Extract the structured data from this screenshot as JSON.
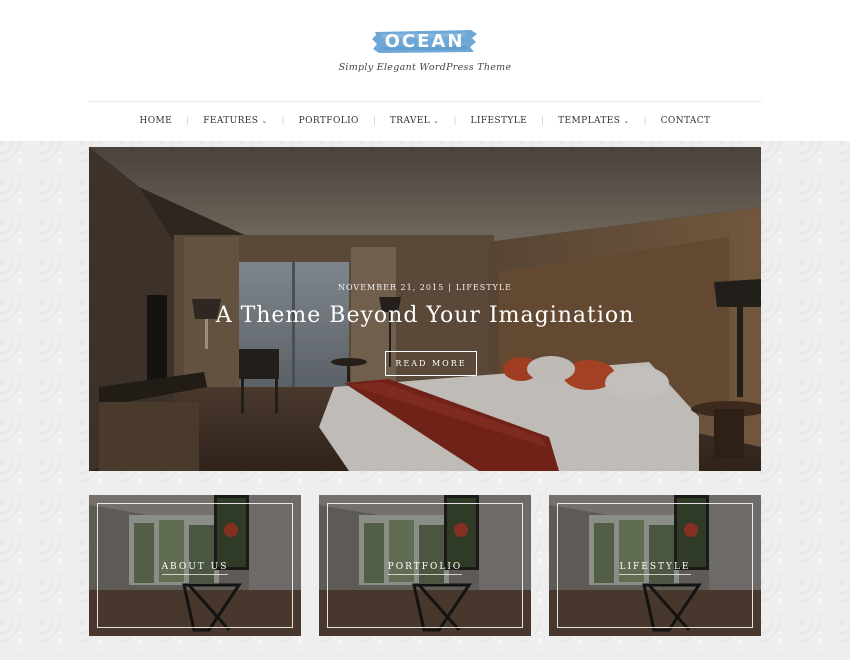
{
  "site": {
    "logo_text": "OCEAN",
    "tagline": "Simply Elegant WordPress Theme",
    "logo_color": "#6fa8d6"
  },
  "nav": {
    "items": [
      {
        "label": "HOME",
        "has_dropdown": false
      },
      {
        "label": "FEATURES",
        "has_dropdown": true
      },
      {
        "label": "PORTFOLIO",
        "has_dropdown": false
      },
      {
        "label": "TRAVEL",
        "has_dropdown": true
      },
      {
        "label": "LIFESTYLE",
        "has_dropdown": false
      },
      {
        "label": "TEMPLATES",
        "has_dropdown": true
      },
      {
        "label": "CONTACT",
        "has_dropdown": false
      }
    ],
    "dropdown_icon": "chevron-down-icon"
  },
  "hero": {
    "date": "NOVEMBER 21, 2015",
    "category": "LIFESTYLE",
    "title": "A Theme Beyond Your Imagination",
    "button_label": "READ MORE"
  },
  "promos": [
    {
      "label": "ABOUT US"
    },
    {
      "label": "PORTFOLIO"
    },
    {
      "label": "LIFESTYLE"
    }
  ]
}
